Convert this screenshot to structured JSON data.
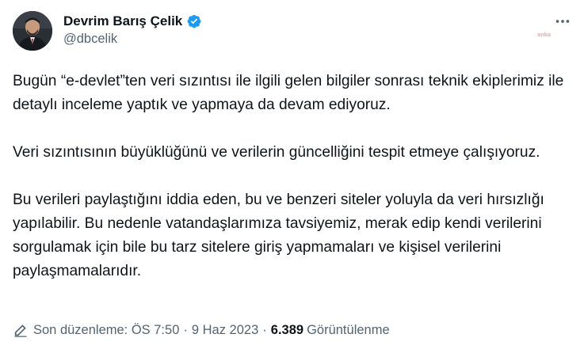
{
  "author": {
    "display_name": "Devrim Barış Çelik",
    "handle": "@dbcelik",
    "verified": true,
    "verified_color": "#1d9bf0"
  },
  "watermark": "anka",
  "tweet": {
    "paragraphs": [
      "Bugün “e-devlet”ten veri sızıntısı ile ilgili gelen bilgiler sonrası teknik ekiplerimiz ile detaylı inceleme yaptık ve yapmaya da devam ediyoruz.",
      "Veri sızıntısının büyüklüğünü ve verilerin güncelliğini tespit etmeye çalışıyoruz.",
      "Bu verileri paylaştığını iddia eden, bu ve benzeri siteler yoluyla da veri hırsızlığı yapılabilir. Bu nedenle vatandaşlarımıza tavsiyemiz, merak edip kendi verilerini sorgulamak için bile bu tarz sitelere giriş yapmamaları ve kişisel verilerini paylaşmamalarıdır."
    ]
  },
  "meta": {
    "edit_icon": "pencil-icon",
    "last_edited": "Son düzenleme: ÖS 7:50",
    "separator": "·",
    "date": "9 Haz 2023",
    "views_count": "6.389",
    "views_label": "Görüntülenme"
  },
  "icons": {
    "more": "more-horizontal-icon",
    "verified": "verified-badge-icon"
  },
  "colors": {
    "text_primary": "#0f1419",
    "text_secondary": "#536471",
    "accent": "#1d9bf0"
  }
}
